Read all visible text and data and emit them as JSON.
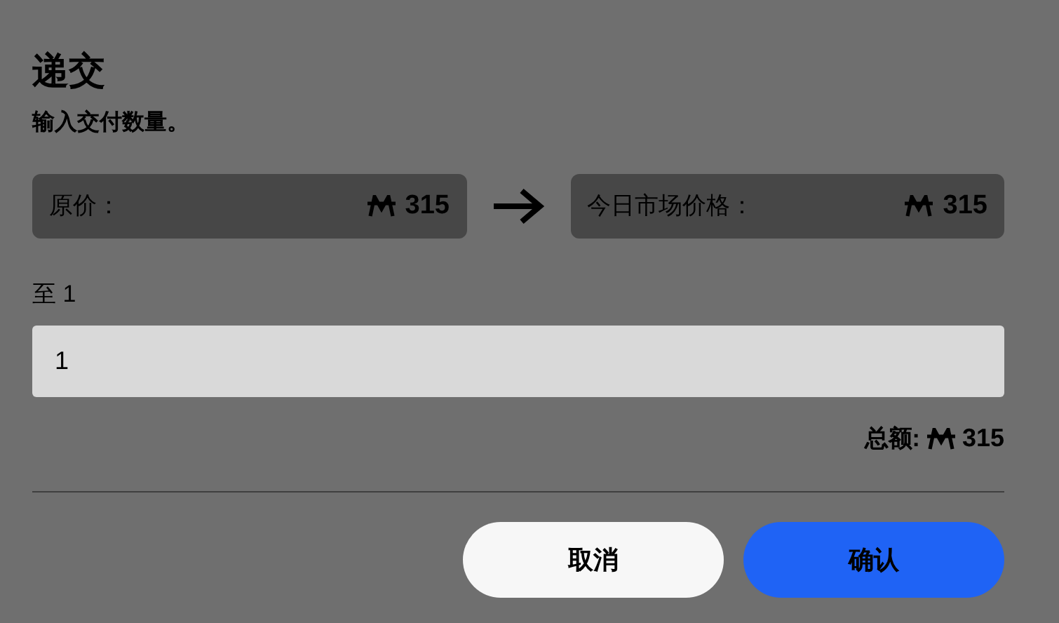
{
  "title": "递交",
  "subtitle": "输入交付数量。",
  "prices": [
    {
      "label": "原价：",
      "amount": "315"
    },
    {
      "label": "今日市场价格：",
      "amount": "315"
    }
  ],
  "quantity": {
    "label": "至 1",
    "value": "1"
  },
  "total": {
    "label": "总额:",
    "amount": "315"
  },
  "buttons": [
    {
      "label": "取消",
      "kind": "secondary"
    },
    {
      "label": "确认",
      "kind": "primary"
    }
  ]
}
